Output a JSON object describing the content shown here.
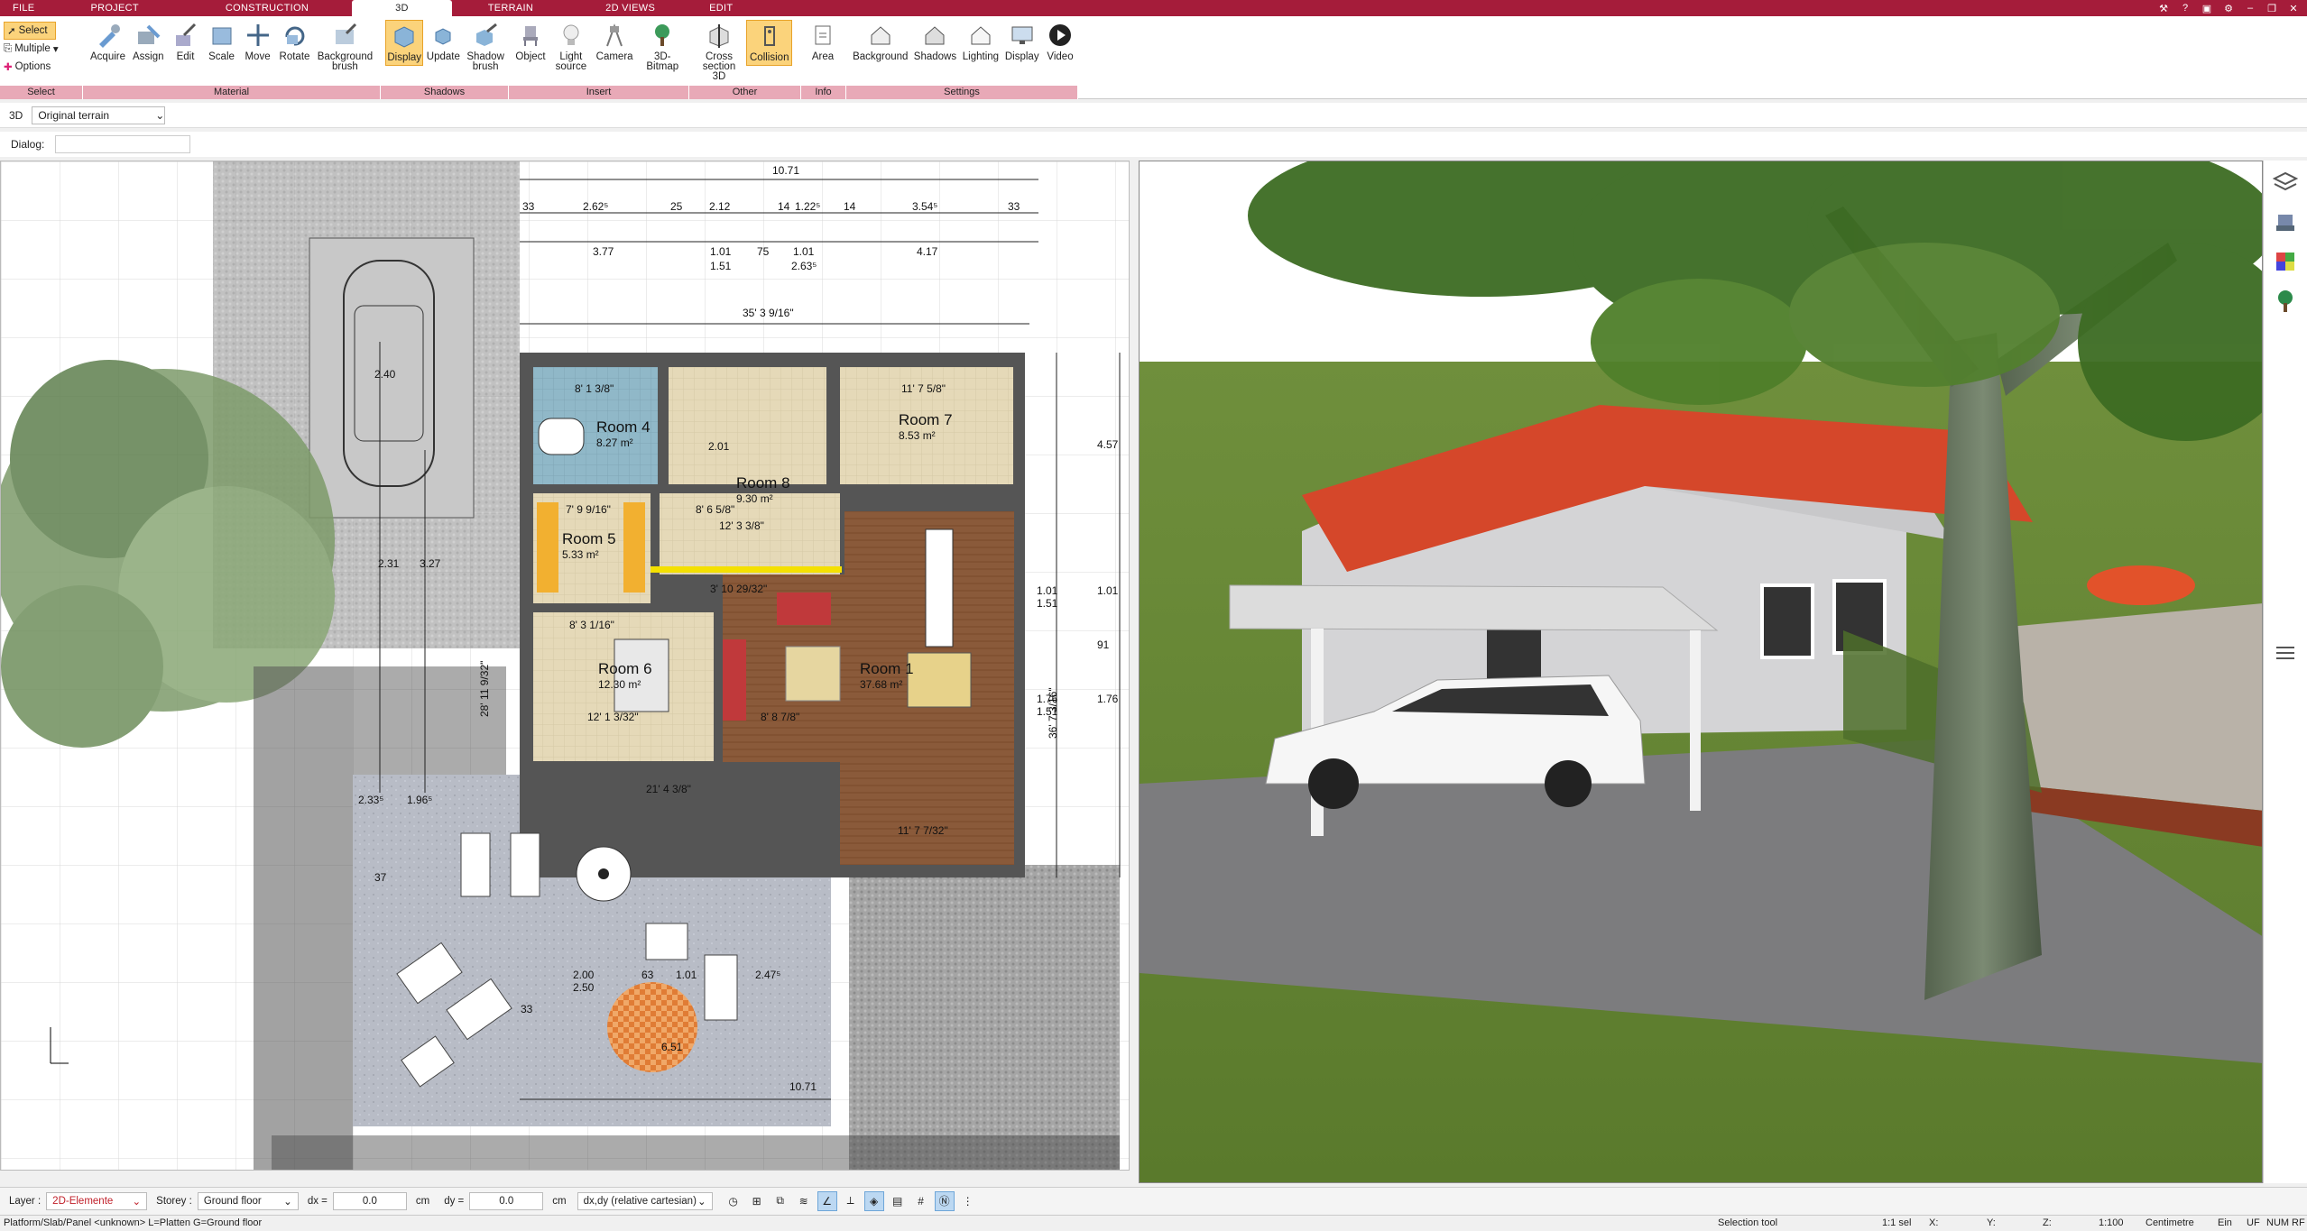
{
  "menu": {
    "tabs": [
      "FILE",
      "PROJECT",
      "CONSTRUCTION",
      "3D",
      "TERRAIN",
      "2D VIEWS",
      "EDIT"
    ],
    "active": "3D"
  },
  "ribbon": {
    "select": {
      "select_label": "Select",
      "multiple_label": "Multiple",
      "options_label": "Options",
      "caption": "Select"
    },
    "material": {
      "items": [
        "Acquire",
        "Assign",
        "Edit",
        "Scale",
        "Move",
        "Rotate",
        "Background brush"
      ],
      "caption": "Material"
    },
    "shadows": {
      "items": [
        "Display",
        "Update",
        "Shadow brush"
      ],
      "caption": "Shadows"
    },
    "insert": {
      "items": [
        "Object",
        "Light source",
        "Camera",
        "3D-Bitmap"
      ],
      "caption": "Insert"
    },
    "other": {
      "items": [
        "Cross section 3D",
        "Collision"
      ],
      "caption": "Other"
    },
    "info": {
      "items": [
        "Area"
      ],
      "caption": "Info"
    },
    "settings": {
      "items": [
        "Background",
        "Shadows",
        "Lighting",
        "Display",
        "Video"
      ],
      "caption": "Settings"
    }
  },
  "viewbar": {
    "mode": "3D",
    "terrain": "Original terrain"
  },
  "dialog": {
    "label": "Dialog:"
  },
  "plan": {
    "dims_top": [
      "10.71",
      "33",
      "2.62⁵",
      "25",
      "2.12",
      "14",
      "1.22⁵",
      "14",
      "3.54⁵",
      "33",
      "3.77",
      "1.01",
      "75",
      "1.01",
      "4.17",
      "1.51",
      "2.63⁵",
      "35' 3 9/16\""
    ],
    "rooms": [
      {
        "name": "Room 4",
        "area": "8.27 m²"
      },
      {
        "name": "Room 7",
        "area": "8.53 m²"
      },
      {
        "name": "Room 8",
        "area": "9.30 m²"
      },
      {
        "name": "Room 5",
        "area": "5.33 m²"
      },
      {
        "name": "Room 6",
        "area": "12.30 m²"
      },
      {
        "name": "Room 1",
        "area": "37.68 m²"
      }
    ],
    "dims_other": [
      "11' 7 5/8\"",
      "8' 1 3/8\"",
      "12' 3 3/8\"",
      "8' 6 5/8\"",
      "7' 9 9/16\"",
      "8' 3 1/16\"",
      "12' 1 3/32\"",
      "21' 4 3/8\"",
      "11' 7 7/32\"",
      "28' 11 9/32\"",
      "36' 7 3/16\"",
      "4.57",
      "1.01",
      "1.51",
      "1.01",
      "1.76",
      "1.51",
      "1.76",
      "2.33⁵",
      "1.96⁵",
      "2.31",
      "3.27",
      "2.40",
      "2.00",
      "2.50",
      "63",
      "1.01",
      "2.47⁵",
      "10.71",
      "6.51",
      "33",
      "37",
      "2.01",
      "3' 10 29/32\"",
      "8' 8 7/8\"",
      "91"
    ]
  },
  "bottom": {
    "layer_label": "Layer :",
    "layer_value": "2D-Elemente",
    "storey_label": "Storey :",
    "storey_value": "Ground floor",
    "dx_label": "dx =",
    "dx_value": "0.0",
    "dy_label": "dy =",
    "dy_value": "0.0",
    "unit": "cm",
    "coord_mode": "dx,dy (relative cartesian)"
  },
  "status": {
    "left": "Platform/Slab/Panel <unknown> L=Platten G=Ground floor",
    "tool": "Selection tool",
    "x": "X:",
    "y": "Y:",
    "z": "Z:",
    "scale1": "1:1 sel",
    "scale2": "1:100",
    "unit": "Centimetre",
    "ein": "Ein",
    "uf": "UF",
    "num": "NUM",
    "rf": "RF"
  },
  "colors": {
    "accent": "#a51c3a",
    "ribbon_caption": "#e8a9b7",
    "highlight": "#fbd37b"
  }
}
